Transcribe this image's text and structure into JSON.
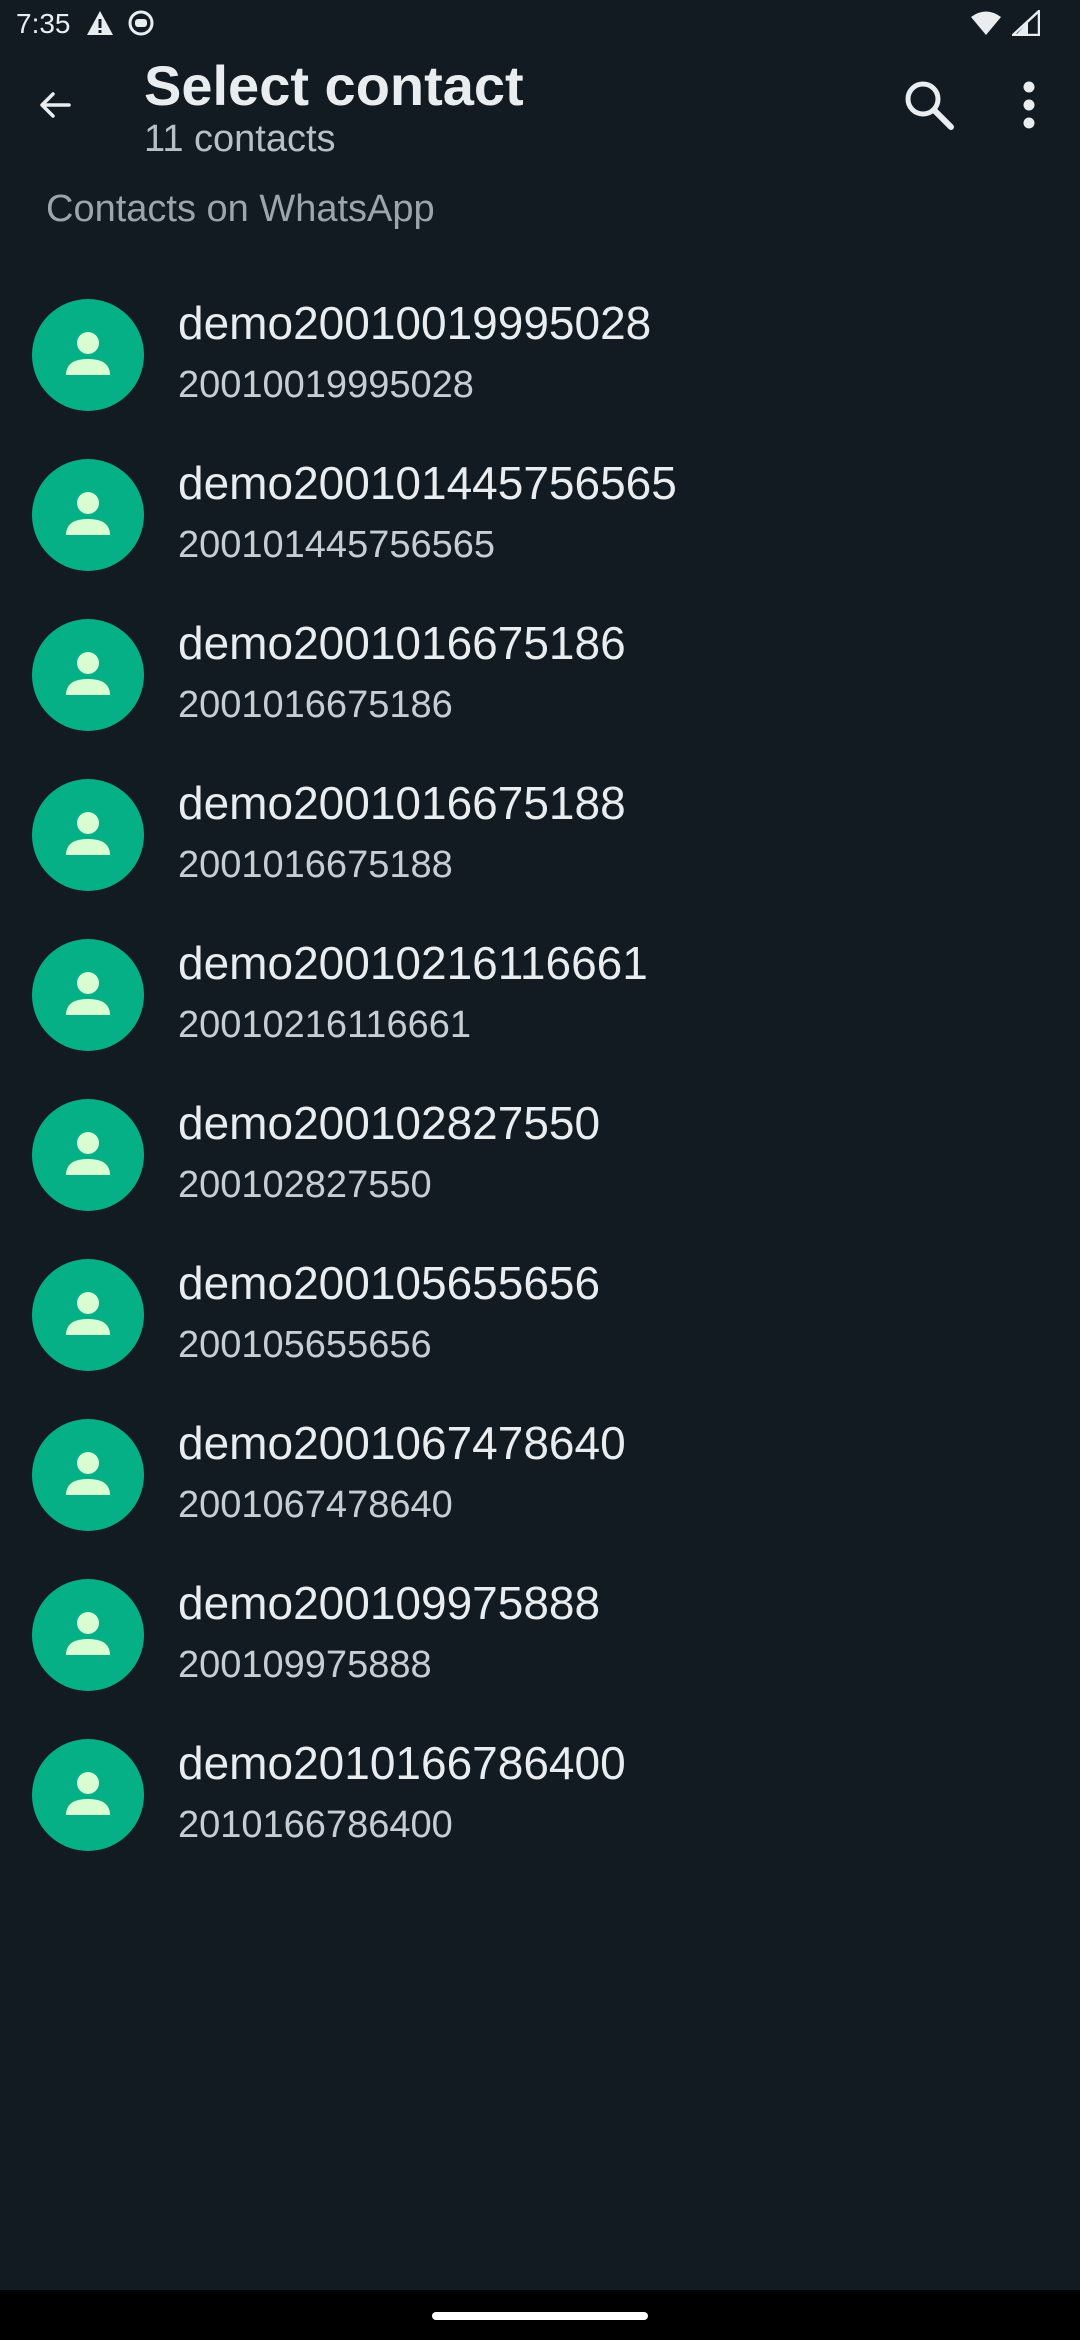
{
  "status_bar": {
    "time": "7:35",
    "icons": [
      "alert-icon",
      "app-notification-icon",
      "wifi-icon",
      "cell-signal-icon"
    ]
  },
  "header": {
    "back_icon": "arrow-left-icon",
    "title": "Select contact",
    "subtitle": "11 contacts",
    "search_icon": "search-icon",
    "menu_icon": "more-vert-icon"
  },
  "section": {
    "label": "Contacts on WhatsApp"
  },
  "contacts": [
    {
      "name": "demo20010019995028",
      "phone": "20010019995028"
    },
    {
      "name": "demo200101445756565",
      "phone": "200101445756565"
    },
    {
      "name": "demo2001016675186",
      "phone": "2001016675186"
    },
    {
      "name": "demo2001016675188",
      "phone": "2001016675188"
    },
    {
      "name": "demo20010216116661",
      "phone": "20010216116661"
    },
    {
      "name": "demo200102827550",
      "phone": "200102827550"
    },
    {
      "name": "demo200105655656",
      "phone": "200105655656"
    },
    {
      "name": "demo2001067478640",
      "phone": "2001067478640"
    },
    {
      "name": "demo200109975888",
      "phone": "200109975888"
    },
    {
      "name": "demo2010166786400",
      "phone": "2010166786400"
    }
  ],
  "colors": {
    "background": "#121b22",
    "avatar": "#06b086",
    "avatar_glyph": "#d9fdd3"
  }
}
